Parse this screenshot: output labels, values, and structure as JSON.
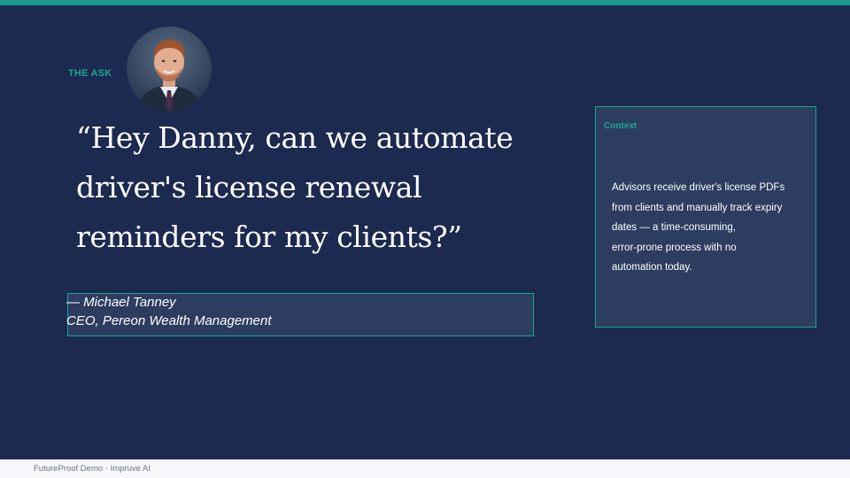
{
  "header": {
    "eyebrow": "THE ASK",
    "avatar_description": "portrait-photo"
  },
  "quote": {
    "lines": [
      "“Hey Danny, can we automate",
      "driver's license renewal",
      "reminders for my clients?”"
    ]
  },
  "attribution": {
    "name": "— Michael Tanney",
    "role": "CEO, Pereon Wealth Management"
  },
  "context": {
    "label": "Context",
    "lines": [
      "Advisors receive driver's license PDFs",
      "from clients and manually track expiry",
      "dates — a time-consuming,",
      "error-prone process with no",
      "automation today."
    ]
  },
  "footer": {
    "text": "FutureProof Demo  ·  Impruve AI"
  },
  "colors": {
    "background": "#1c2a4f",
    "accent": "#179c8f",
    "panel": "#2c3d5f",
    "footer": "#f5f7fa"
  }
}
